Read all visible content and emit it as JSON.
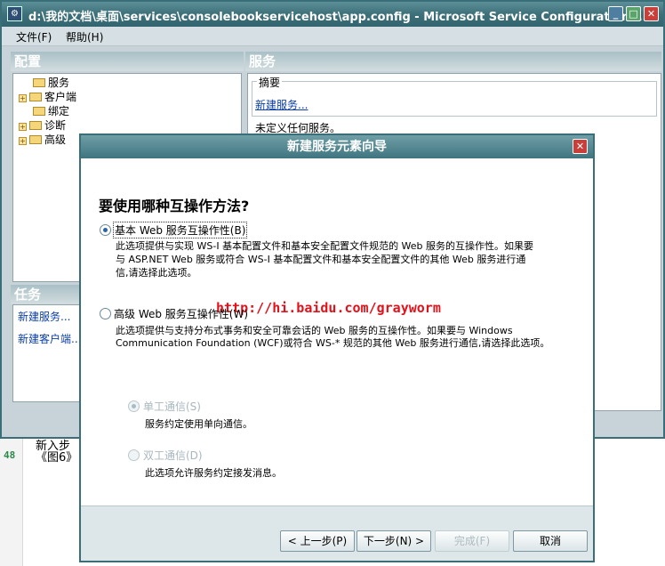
{
  "main_window": {
    "title": "d:\\我的文档\\桌面\\services\\consolebookservicehost\\app.config - Microsoft Service Configuration ...",
    "menu": [
      "文件(F)",
      "帮助(H)"
    ],
    "config_header": "配置",
    "services_header": "服务",
    "tree_items": [
      {
        "label": "服务",
        "expandable": false
      },
      {
        "label": "客户端",
        "expandable": true
      },
      {
        "label": "绑定",
        "expandable": false
      },
      {
        "label": "诊断",
        "expandable": true
      },
      {
        "label": "高级",
        "expandable": true
      }
    ],
    "tasks_header": "任务",
    "tasks": [
      "新建服务...",
      "新建客户端..."
    ],
    "summary_legend": "摘要",
    "new_service_link": "新建服务...",
    "no_service_text": "未定义任何服务。"
  },
  "editor": {
    "line_number": "48",
    "line_text": "《图6》",
    "faint_text": "新入步"
  },
  "dialog": {
    "title": "新建服务元素向导",
    "question": "要使用哪种互操作方法?",
    "option_basic": {
      "label": "基本 Web 服务互操作性(B)",
      "desc_line1": "此选项提供与实现 WS-I 基本配置文件和基本安全配置文件规范的 Web 服务的互操作性。如果要",
      "desc_line2": "与 ASP.NET Web 服务或符合 WS-I 基本配置文件和基本安全配置文件的其他 Web 服务进行通",
      "desc_line3": "信,请选择此选项。",
      "selected": true
    },
    "watermark_url": "http://hi.baidu.com/grayworm",
    "option_advanced": {
      "label": "高级 Web 服务互操作性(W)",
      "desc_line1": "此选项提供与支持分布式事务和安全可靠会话的 Web 服务的互操作性。如果要与 Windows",
      "desc_line2": "Communication Foundation (WCF)或符合 WS-* 规范的其他 Web 服务进行通信,请选择此选项。",
      "selected": false
    },
    "sub_option_simplex": {
      "label": "单工通信(S)",
      "desc": "服务约定使用单向通信。",
      "selected": true,
      "enabled": false
    },
    "sub_option_duplex": {
      "label": "双工通信(D)",
      "desc": "此选项允许服务约定接发消息。",
      "selected": false,
      "enabled": false
    },
    "buttons": {
      "back": "< 上一步(P)",
      "next": "下一步(N) >",
      "finish": "完成(F)",
      "cancel": "取消"
    }
  },
  "colors": {
    "title_bar": "#3d7079",
    "link": "#0b3ea6",
    "url_red": "#e3121a"
  }
}
